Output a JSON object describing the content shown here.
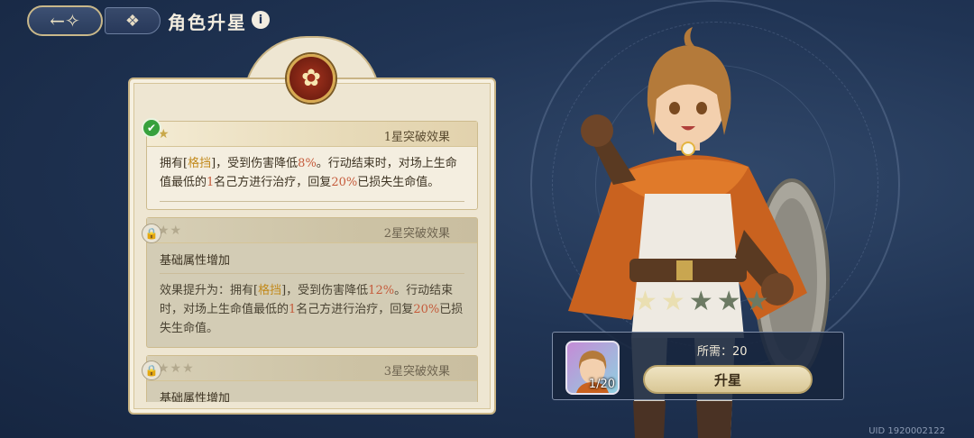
{
  "header": {
    "back_icon": "back-arrow-icon",
    "menu_icon": "grid-icon",
    "title": "角色升星",
    "info_icon": "i"
  },
  "emblem_icon": "flower-emblem-icon",
  "sections": [
    {
      "stars": "★",
      "title": "1星突破效果",
      "state": "unlocked",
      "badge_icon": "✔",
      "body": [
        {
          "t": "拥有["
        },
        {
          "t": "格挡",
          "c": "gold"
        },
        {
          "t": "]，受到伤害降低"
        },
        {
          "t": "8%",
          "c": "red"
        },
        {
          "t": "。行动结束时，对场上生命值最低的"
        },
        {
          "t": "1",
          "c": "red"
        },
        {
          "t": "名己方进行治疗，回复"
        },
        {
          "t": "20%",
          "c": "red"
        },
        {
          "t": "已损失生命值。"
        }
      ]
    },
    {
      "stars": "★★",
      "title": "2星突破效果",
      "state": "locked",
      "badge_icon": "🔒",
      "sub": "基础属性增加",
      "body": [
        {
          "t": "效果提升为：拥有["
        },
        {
          "t": "格挡",
          "c": "gold"
        },
        {
          "t": "]，受到伤害降低"
        },
        {
          "t": "12%",
          "c": "red"
        },
        {
          "t": "。行动结束时，对场上生命值最低的"
        },
        {
          "t": "1",
          "c": "red"
        },
        {
          "t": "名己方进行治疗，回复"
        },
        {
          "t": "20%",
          "c": "red"
        },
        {
          "t": "已损失生命值。"
        }
      ]
    },
    {
      "stars": "★★★",
      "title": "3星突破效果",
      "state": "locked",
      "badge_icon": "🔒",
      "sub": "基础属性增加"
    }
  ],
  "character_stars": {
    "filled": 2,
    "total": 5
  },
  "upgrade": {
    "required_label": "所需：20",
    "owned_count": "1/20",
    "button_label": "升星"
  },
  "uid": "UID 1920002122",
  "colors": {
    "accent_red": "#c55a3a",
    "accent_gold": "#c28a1c",
    "parchment": "#eee6d2",
    "navy": "#203454"
  }
}
